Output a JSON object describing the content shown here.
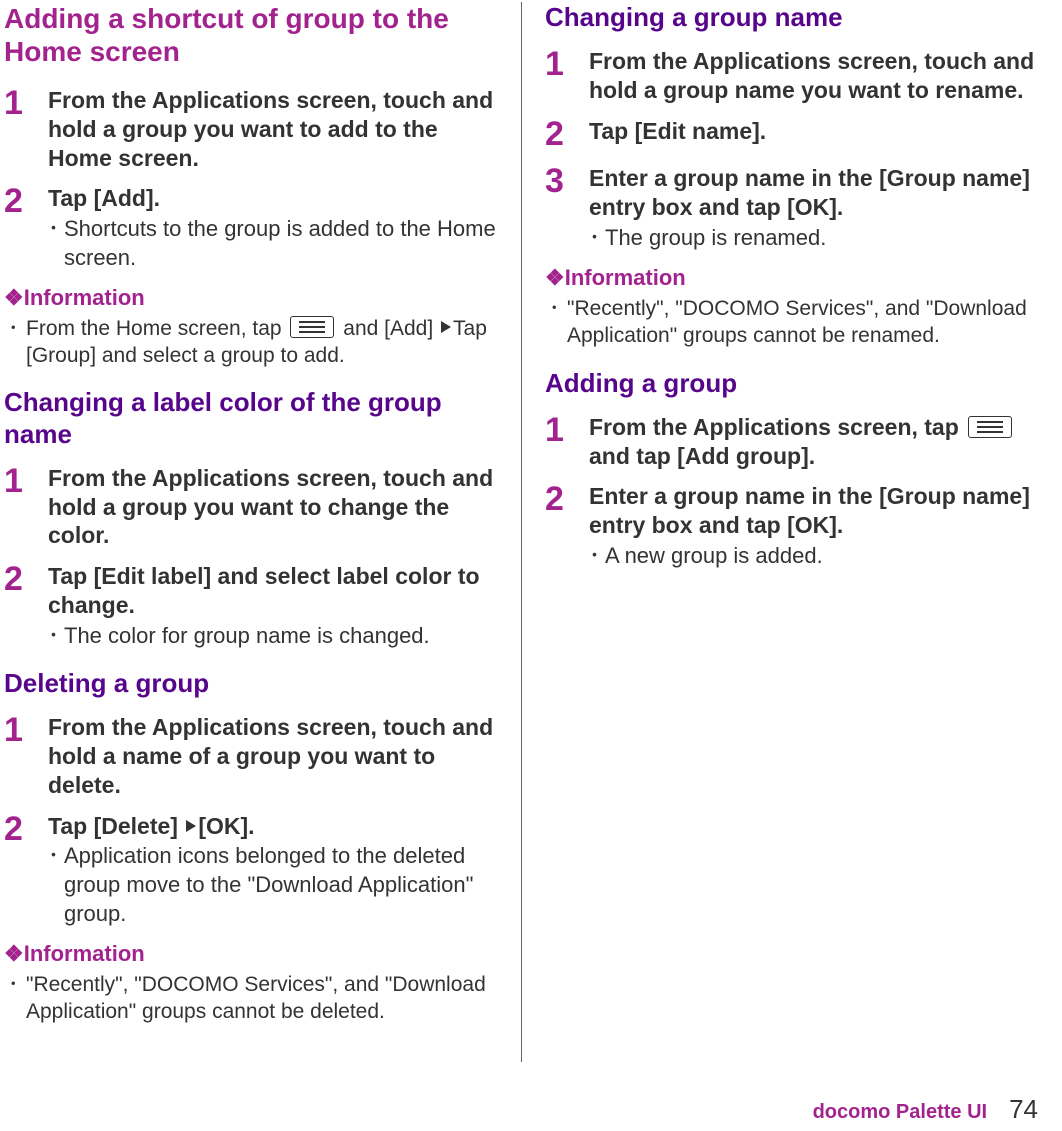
{
  "left": {
    "section_a": {
      "heading": "Adding a shortcut of group to the Home screen",
      "step1": {
        "num": "1",
        "title": "From the Applications screen, touch and hold a group you want to add to the Home screen."
      },
      "step2": {
        "num": "2",
        "title": "Tap [Add].",
        "bullet": "Shortcuts to the group is added to the Home screen."
      },
      "info_label": "Information",
      "info_pre": "From the Home screen, tap ",
      "info_mid": " and [Add] ",
      "info_post": "Tap [Group] and select a group to add."
    },
    "section_b": {
      "heading": "Changing a label color of the group name",
      "step1": {
        "num": "1",
        "title": "From the Applications screen, touch and hold a group you want to change the color."
      },
      "step2": {
        "num": "2",
        "title": "Tap [Edit label] and select label color to change.",
        "bullet": "The color for group name is changed."
      }
    },
    "section_c": {
      "heading": "Deleting a group",
      "step1": {
        "num": "1",
        "title": "From the Applications screen, touch and hold a name of a group you want to delete."
      }
    }
  },
  "right": {
    "section_c2": {
      "step2": {
        "num": "2",
        "title_pre": "Tap [Delete] ",
        "title_post": "[OK].",
        "bullet": "Application icons belonged to the deleted group move to the \"Download Application\" group."
      },
      "info_label": "Information",
      "info_text": "\"Recently\", \"DOCOMO Services\", and \"Download Application\" groups cannot be deleted."
    },
    "section_d": {
      "heading": "Changing a group name",
      "step1": {
        "num": "1",
        "title": "From the Applications screen, touch and hold a group name you want to rename."
      },
      "step2": {
        "num": "2",
        "title": "Tap [Edit name]."
      },
      "step3": {
        "num": "3",
        "title": "Enter a group name in the [Group name] entry box and tap [OK].",
        "bullet": "The group is renamed."
      },
      "info_label": "Information",
      "info_text": "\"Recently\", \"DOCOMO Services\", and \"Download Application\" groups cannot be renamed."
    },
    "section_e": {
      "heading": "Adding a group",
      "step1": {
        "num": "1",
        "title_pre": "From the Applications screen, tap ",
        "title_post": " and tap [Add group]."
      },
      "step2": {
        "num": "2",
        "title": "Enter a group name in the [Group name] entry box and tap [OK].",
        "bullet": "A new group is added."
      }
    }
  },
  "footer": {
    "brand": "docomo Palette UI",
    "page": "74"
  }
}
